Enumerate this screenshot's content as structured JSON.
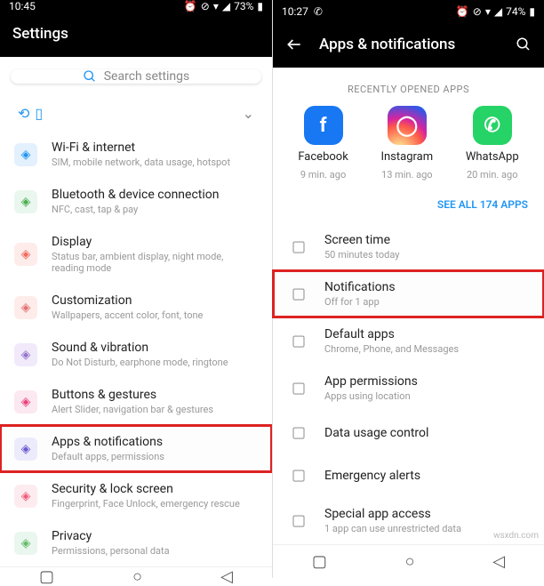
{
  "left": {
    "statusbar": {
      "time": "10:45",
      "battery": "73%"
    },
    "header": {
      "title": "Settings"
    },
    "search": {
      "placeholder": "Search settings"
    },
    "items": [
      {
        "icon": "wifi",
        "color": "#e3f0fd",
        "fg": "#2196f3",
        "title": "Wi-Fi & internet",
        "sub": "SIM, mobile network, data usage, hotspot"
      },
      {
        "icon": "bt",
        "color": "#e9f7ee",
        "fg": "#4caf50",
        "title": "Bluetooth & device connection",
        "sub": "NFC, cast, tap & pay"
      },
      {
        "icon": "disp",
        "color": "#fdecea",
        "fg": "#f06a5c",
        "title": "Display",
        "sub": "Status bar, ambient display, night mode, reading mode"
      },
      {
        "icon": "cust",
        "color": "#fdecea",
        "fg": "#e57373",
        "title": "Customization",
        "sub": "Wallpapers, accent color, font, tone"
      },
      {
        "icon": "sound",
        "color": "#f1eafb",
        "fg": "#9575cd",
        "title": "Sound & vibration",
        "sub": "Do Not Disturb, earphone mode, ringtone"
      },
      {
        "icon": "btn",
        "color": "#fce8f1",
        "fg": "#ec407a",
        "title": "Buttons & gestures",
        "sub": "Alert Slider, navigation bar & gestures"
      },
      {
        "icon": "apps",
        "color": "#ecebfb",
        "fg": "#6a5bd0",
        "title": "Apps & notifications",
        "sub": "Default apps, permissions",
        "highlight": true
      },
      {
        "icon": "lock",
        "color": "#fdecef",
        "fg": "#ef5d7a",
        "title": "Security & lock screen",
        "sub": "Fingerprint, Face Unlock, emergency rescue"
      },
      {
        "icon": "priv",
        "color": "#e9f7ee",
        "fg": "#66bb6a",
        "title": "Privacy",
        "sub": "Permissions, personal data"
      }
    ]
  },
  "right": {
    "statusbar": {
      "time": "10:27",
      "battery": "74%"
    },
    "header": {
      "title": "Apps & notifications"
    },
    "section_title": "RECENTLY OPENED APPS",
    "apps": [
      {
        "name": "Facebook",
        "sub": "9 min. ago",
        "cls": "fb",
        "letter": "f"
      },
      {
        "name": "Instagram",
        "sub": "13 min. ago",
        "cls": "ig",
        "letter": "◯"
      },
      {
        "name": "WhatsApp",
        "sub": "20 min. ago",
        "cls": "wa",
        "letter": "✆"
      }
    ],
    "see_all": "SEE ALL 174 APPS",
    "items": [
      {
        "title": "Screen time",
        "sub": "50 minutes today"
      },
      {
        "title": "Notifications",
        "sub": "Off for 1 app",
        "highlight": true
      },
      {
        "title": "Default apps",
        "sub": "Chrome, Phone, and Messages"
      },
      {
        "title": "App permissions",
        "sub": "Apps using location"
      },
      {
        "title": "Data usage control",
        "sub": ""
      },
      {
        "title": "Emergency alerts",
        "sub": ""
      },
      {
        "title": "Special app access",
        "sub": "1 app can use unrestricted data"
      }
    ]
  },
  "watermark": "wsxdn.com"
}
